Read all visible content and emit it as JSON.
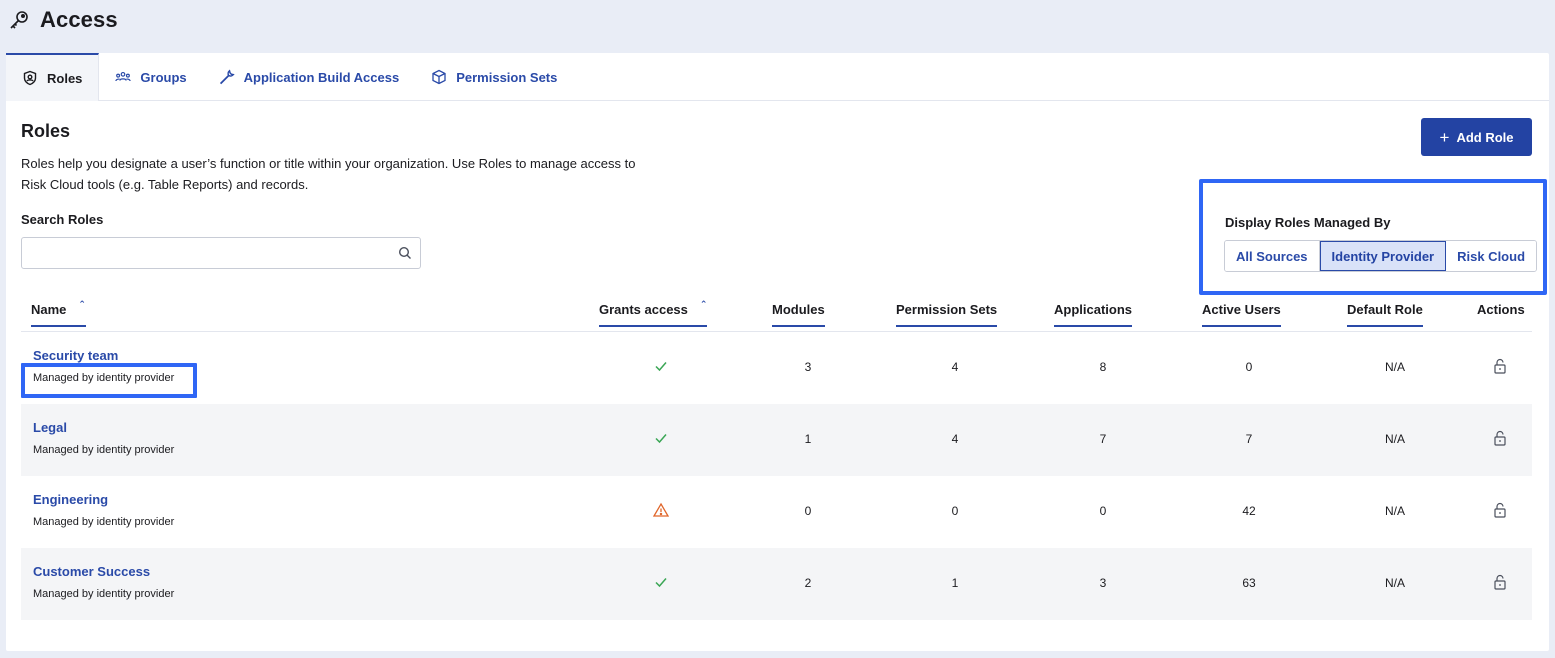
{
  "page": {
    "title": "Access",
    "icon": "key-icon"
  },
  "tabs": [
    {
      "label": "Roles",
      "icon": "shield-user-icon",
      "active": true
    },
    {
      "label": "Groups",
      "icon": "users-group-icon",
      "active": false
    },
    {
      "label": "Application Build Access",
      "icon": "wrench-icon",
      "active": false
    },
    {
      "label": "Permission Sets",
      "icon": "cube-icon",
      "active": false
    }
  ],
  "roles_section": {
    "title": "Roles",
    "description": "Roles help you designate a user’s function or title within your organization. Use Roles to manage access to Risk Cloud tools (e.g. Table Reports) and records.",
    "add_button": "Add Role",
    "search_label": "Search Roles",
    "search_value": "",
    "search_placeholder": ""
  },
  "filter": {
    "label": "Display Roles Managed By",
    "options": [
      "All Sources",
      "Identity Provider",
      "Risk Cloud"
    ],
    "selected": "Identity Provider"
  },
  "table": {
    "columns": [
      "Name",
      "Grants access",
      "Modules",
      "Permission Sets",
      "Applications",
      "Active Users",
      "Default Role",
      "Actions"
    ],
    "rows": [
      {
        "name": "Security team",
        "managed": "Managed by identity provider",
        "grants": "check",
        "modules": "3",
        "permission_sets": "4",
        "applications": "8",
        "active_users": "0",
        "default_role": "N/A",
        "action": "lock-icon"
      },
      {
        "name": "Legal",
        "managed": "Managed by identity provider",
        "grants": "check",
        "modules": "1",
        "permission_sets": "4",
        "applications": "7",
        "active_users": "7",
        "default_role": "N/A",
        "action": "lock-icon"
      },
      {
        "name": "Engineering",
        "managed": "Managed by identity provider",
        "grants": "warning",
        "modules": "0",
        "permission_sets": "0",
        "applications": "0",
        "active_users": "42",
        "default_role": "N/A",
        "action": "lock-icon"
      },
      {
        "name": "Customer Success",
        "managed": "Managed by identity provider",
        "grants": "check",
        "modules": "2",
        "permission_sets": "1",
        "applications": "3",
        "active_users": "63",
        "default_role": "N/A",
        "action": "lock-icon"
      }
    ]
  },
  "colors": {
    "primary": "#2343a3",
    "link": "#2a4aa8",
    "highlight": "#2f66f5",
    "success": "#3aa655",
    "warning": "#e0662b"
  }
}
